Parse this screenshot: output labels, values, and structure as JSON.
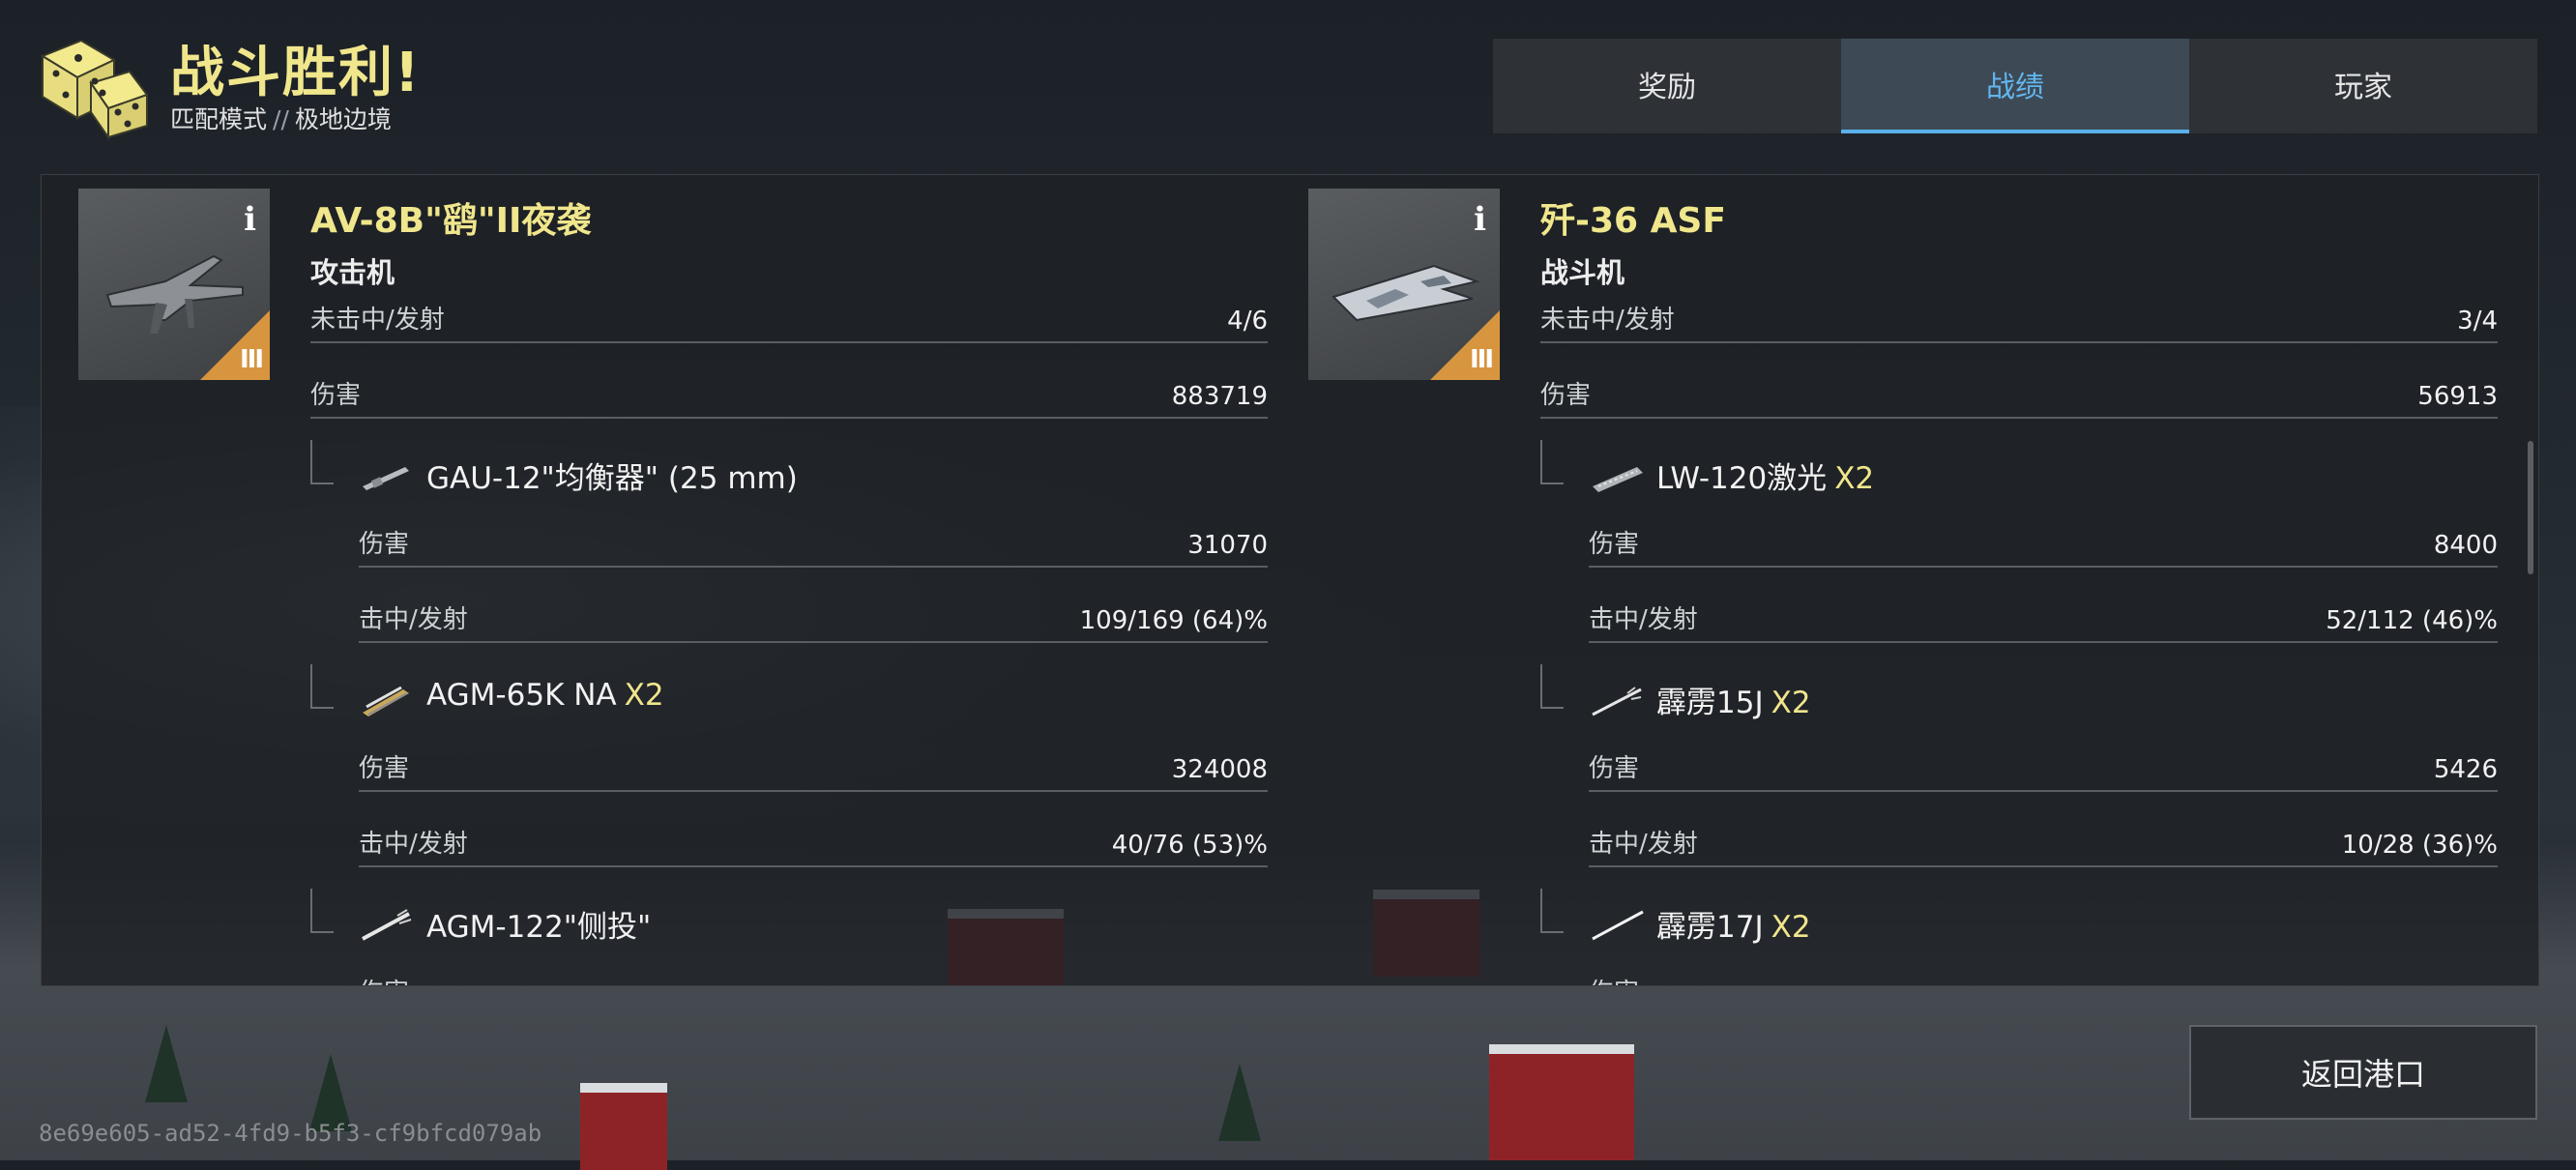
{
  "header": {
    "title": "战斗胜利!",
    "mode": "匹配模式",
    "separator": "//",
    "map": "极地边境"
  },
  "tabs": [
    {
      "label": "奖励",
      "active": false
    },
    {
      "label": "战绩",
      "active": true
    },
    {
      "label": "玩家",
      "active": false
    }
  ],
  "vehicles": [
    {
      "name": "AV-8B\"鹞\"II夜袭",
      "class": "攻击机",
      "tier": "III",
      "info": "i",
      "stats": [
        {
          "label": "未击中/发射",
          "value": "4/6"
        },
        {
          "label": "伤害",
          "value": "883719"
        }
      ],
      "weapons": [
        {
          "name": "GAU-12\"均衡器\" (25 mm)",
          "multiplier": "",
          "icon": "cannon-icon",
          "damage_label": "伤害",
          "damage": "31070",
          "hit_label": "击中/发射",
          "hits": "109/169 (64)%"
        },
        {
          "name": "AGM-65K NA",
          "multiplier": "X2",
          "icon": "missile-pod-icon",
          "damage_label": "伤害",
          "damage": "324008",
          "hit_label": "击中/发射",
          "hits": "40/76 (53)%"
        },
        {
          "name": "AGM-122\"侧投\"",
          "multiplier": "",
          "icon": "missile-icon",
          "damage_label": "伤害",
          "damage": "",
          "hit_label": "",
          "hits": ""
        }
      ]
    },
    {
      "name": "歼-36 ASF",
      "class": "战斗机",
      "tier": "III",
      "info": "i",
      "stats": [
        {
          "label": "未击中/发射",
          "value": "3/4"
        },
        {
          "label": "伤害",
          "value": "56913"
        }
      ],
      "weapons": [
        {
          "name": "LW-120激光",
          "multiplier": "X2",
          "icon": "laser-icon",
          "damage_label": "伤害",
          "damage": "8400",
          "hit_label": "击中/发射",
          "hits": "52/112 (46)%"
        },
        {
          "name": "霹雳15J",
          "multiplier": "X2",
          "icon": "missile-icon",
          "damage_label": "伤害",
          "damage": "5426",
          "hit_label": "击中/发射",
          "hits": "10/28 (36)%"
        },
        {
          "name": "霹雳17J",
          "multiplier": "X2",
          "icon": "missile-icon",
          "damage_label": "伤害",
          "damage": "",
          "hit_label": "",
          "hits": ""
        }
      ]
    }
  ],
  "footer": {
    "return_button": "返回港口",
    "session_id": "8e69e605-ad52-4fd9-b5f3-cf9bfcd079ab"
  },
  "colors": {
    "title_yellow": "#f0e68c",
    "tab_active_blue": "#62b6ef",
    "tier_orange": "#d7953f"
  }
}
